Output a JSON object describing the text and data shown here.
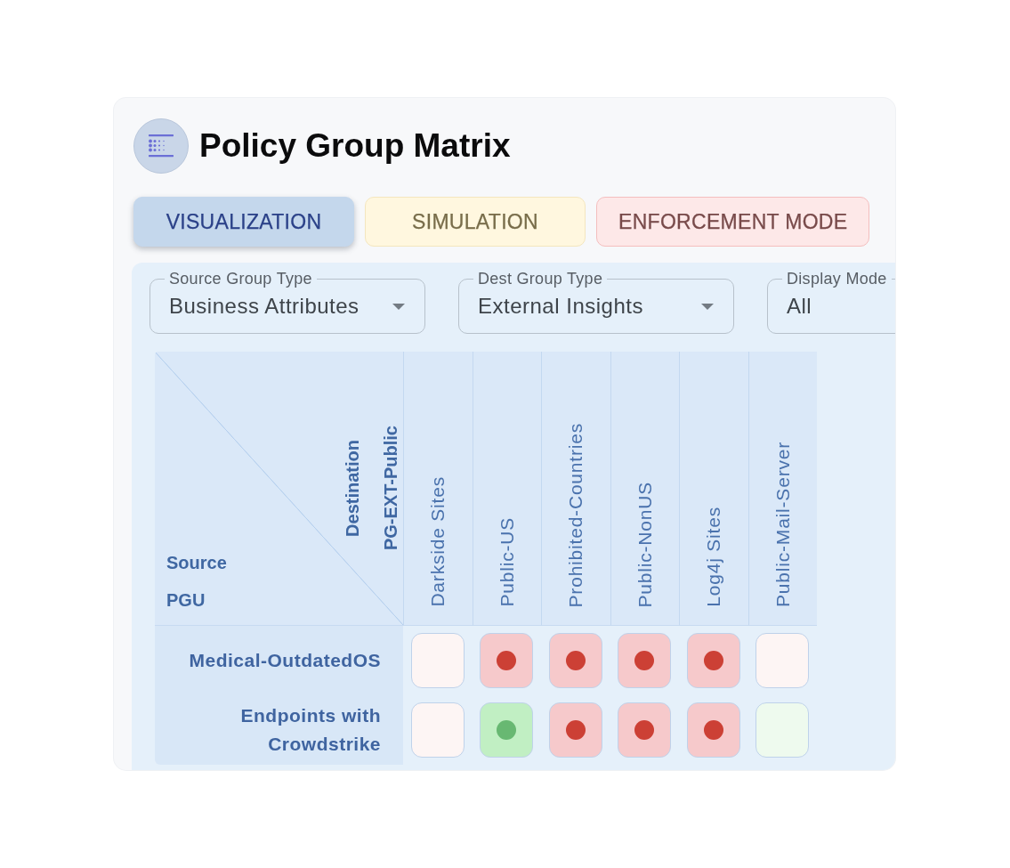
{
  "header": {
    "title": "Policy Group Matrix"
  },
  "tabs": [
    {
      "label": "VISUALIZATION",
      "selected": true,
      "color": "#c4d7ec"
    },
    {
      "label": "SIMULATION",
      "selected": false,
      "color": "#fff7df"
    },
    {
      "label": "ENFORCEMENT MODE",
      "selected": false,
      "color": "#fde8e8"
    }
  ],
  "filters": [
    {
      "label": "Source Group Type",
      "value": "Business Attributes"
    },
    {
      "label": "Dest Group Type",
      "value": "External Insights"
    },
    {
      "label": "Display Mode",
      "value": "All"
    }
  ],
  "matrix": {
    "corner": {
      "destination_title": "Destination",
      "destination_group": "PG-EXT-Public",
      "source_title": "Source",
      "source_group": "PGU"
    },
    "columns": [
      "Darkside Sites",
      "Public-US",
      "Prohibited-Countries",
      "Public-NonUS",
      "Log4j Sites",
      "Public-Mail-Server"
    ],
    "rows": [
      {
        "label": "Medical-OutdatedOS",
        "cells": [
          {
            "kind": "deny",
            "dot": false
          },
          {
            "kind": "deny",
            "dot": true
          },
          {
            "kind": "deny",
            "dot": true
          },
          {
            "kind": "deny",
            "dot": true
          },
          {
            "kind": "deny",
            "dot": true
          },
          {
            "kind": "deny",
            "dot": false
          }
        ]
      },
      {
        "label": "Endpoints with Crowdstrike",
        "cells": [
          {
            "kind": "deny",
            "dot": false
          },
          {
            "kind": "allow",
            "dot": true
          },
          {
            "kind": "deny",
            "dot": true
          },
          {
            "kind": "deny",
            "dot": true
          },
          {
            "kind": "deny",
            "dot": true
          },
          {
            "kind": "allow",
            "dot": false
          }
        ]
      }
    ]
  }
}
